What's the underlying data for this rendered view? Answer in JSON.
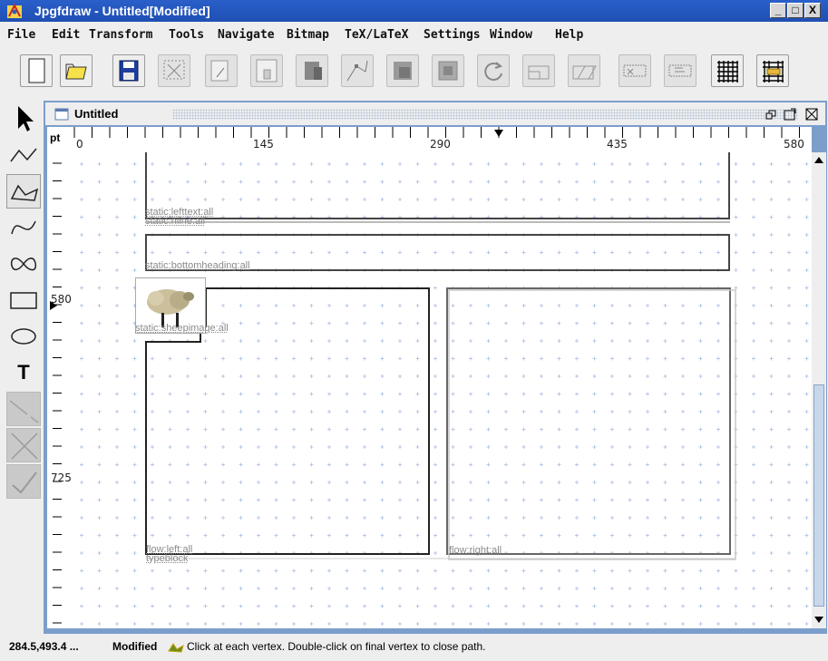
{
  "window": {
    "title": "Jpgfdraw - Untitled[Modified]",
    "buttons": [
      "_",
      "□",
      "X"
    ]
  },
  "menu": [
    "File",
    "Edit",
    "Transform",
    "Tools",
    "Navigate",
    "Bitmap",
    "TeX/LaTeX",
    "Settings",
    "Window",
    "Help"
  ],
  "toolbar": {
    "icons": [
      "new-document-icon",
      "open-folder-icon",
      "save-disk-icon",
      "select-region-icon",
      "edit-path-icon",
      "justify-icon",
      "bitmap-icon",
      "vertex-icon",
      "group-icon",
      "ungroup-icon",
      "rotate-icon",
      "scale-icon",
      "shear-icon",
      "frame-icon",
      "frame-edit-icon",
      "grid-icon",
      "grid-lock-icon"
    ]
  },
  "left_tools": [
    "select-arrow-icon",
    "open-line-icon",
    "closed-line-icon",
    "open-curve-icon",
    "closed-curve-icon",
    "rectangle-icon",
    "ellipse-icon",
    "text-tool-icon",
    "gap-icon",
    "abandon-icon",
    "finish-icon"
  ],
  "text_tool_label": "T",
  "document": {
    "title": "Untitled",
    "window_icons": [
      "restore-icon",
      "maximize-icon",
      "close-icon"
    ]
  },
  "ruler": {
    "unit": "pt",
    "top_labels": [
      "0",
      "145",
      "290",
      "435",
      "580"
    ],
    "left_labels": [
      "580",
      "725"
    ]
  },
  "frames": {
    "lefttext": "static:lefttext:all",
    "hfline": "static:hline:all",
    "bottomheading": "static:bottomheading:all",
    "sheepimage": "static:sheepimage:all",
    "flowleft": "flow:left:all",
    "typeblock": "typeblock",
    "flowright": "flow:right:all"
  },
  "status": {
    "coords": "284.5,493.4 ...",
    "modified": "Modified",
    "message": "Click at each vertex. Double-click on final vertex to close path."
  },
  "colors": {
    "title_bar": "#2a5fc9",
    "frame_border": "#7b9ecb",
    "grid_plus": "#a8bde0"
  }
}
